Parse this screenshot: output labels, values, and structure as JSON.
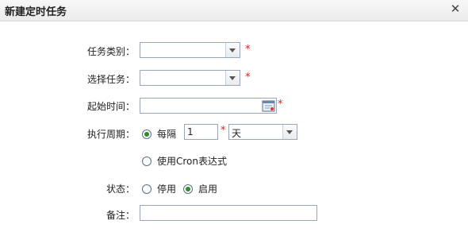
{
  "dialog": {
    "title": "新建定时任务",
    "close_icon": "close-icon"
  },
  "form": {
    "task_category": {
      "label": "任务类别：",
      "value": "",
      "required_mark": "*"
    },
    "select_task": {
      "label": "选择任务：",
      "value": "",
      "required_mark": "*"
    },
    "start_time": {
      "label": "起始时间：",
      "value": "",
      "required_mark": "*",
      "icon": "calendar-icon"
    },
    "period": {
      "label": "执行周期：",
      "option_every": {
        "label": "每隔",
        "selected": true
      },
      "interval_value": "1",
      "required_mark": "*",
      "unit_value": "天",
      "option_cron": {
        "label": "使用Cron表达式",
        "selected": false
      }
    },
    "status": {
      "label": "状态：",
      "option_disabled": {
        "label": "停用",
        "selected": false
      },
      "option_enabled": {
        "label": "启用",
        "selected": true
      }
    },
    "remark": {
      "label": "备注：",
      "value": ""
    }
  }
}
